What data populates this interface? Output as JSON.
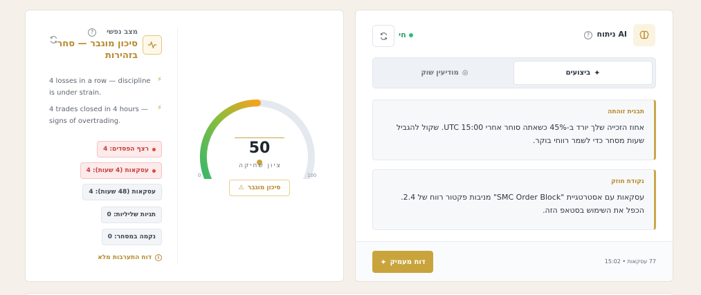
{
  "ai_panel": {
    "title": "ניתוח AI",
    "live_label": "חי",
    "tabs": [
      {
        "label": "ביצועים",
        "active": true
      },
      {
        "label": "מודיעין שוק",
        "active": false
      }
    ],
    "insights": [
      {
        "label": "תבנית זוהתה",
        "text": "אחוז הזכייה שלך יורד ב-45% כשאתה סוחר אחרי UTC 15:00. שקול להגביל שעות מסחר כדי לשמר רווחי בוקר."
      },
      {
        "label": "נקודת חוזק",
        "text": "עסקאות עם אסטרטגיית \"SMC Order Block\" מניבות פקטור רווח של 2.4. הכפל את השימוש בסטאפ הזה."
      }
    ],
    "footer_meta": "77 עסקאות • 15:02",
    "deep_report_label": "דוח מעמיק"
  },
  "mind_panel": {
    "label": "מצב נפשי",
    "state": "סיכון מוגבר — סחר בזהירות",
    "reasons": [
      "4 losses in a row — discipline is under strain.",
      "4 trades closed in 4 hours — signs of overtrading."
    ],
    "badges": [
      {
        "text": "רצף הפסדים: 4",
        "style": "red"
      },
      {
        "text": "עסקאות (4 שעות): 4",
        "style": "red"
      },
      {
        "text": "עסקאות (48 שעות): 4",
        "style": "gray"
      },
      {
        "text": "תגיות שליליות: 0",
        "style": "gray"
      },
      {
        "text": "נקמה במסחר: 0",
        "style": "gray"
      }
    ],
    "full_report_label": "דוח התערבות מלא",
    "gauge": {
      "value": 50,
      "min_label": "0",
      "max_label": "100",
      "sub_label": "ציון שחיקה",
      "risk_chip": "סיכון מוגבר"
    }
  },
  "colors": {
    "accent_gold": "#c9a43c",
    "live_green": "#27a36a",
    "alert_red": "#c5403f"
  }
}
